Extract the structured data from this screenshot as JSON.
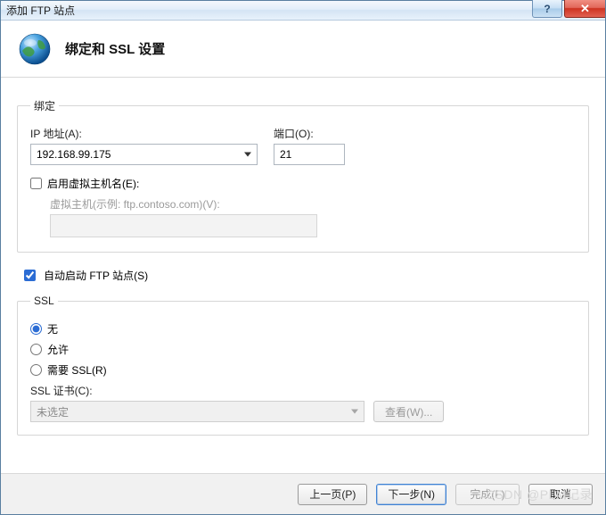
{
  "window": {
    "title": "添加 FTP 站点"
  },
  "header": {
    "title": "绑定和 SSL 设置"
  },
  "binding": {
    "legend": "绑定",
    "ip_label": "IP 地址(A):",
    "ip_value": "192.168.99.175",
    "port_label": "端口(O):",
    "port_value": "21",
    "vhost_checkbox": "启用虚拟主机名(E):",
    "vhost_label": "虚拟主机(示例: ftp.contoso.com)(V):",
    "vhost_value": ""
  },
  "auto_start": {
    "label": "自动启动 FTP 站点(S)"
  },
  "ssl": {
    "legend": "SSL",
    "opt_none": "无",
    "opt_allow": "允许",
    "opt_require": "需要 SSL(R)",
    "cert_label": "SSL 证书(C):",
    "cert_value": "未选定",
    "view_btn": "查看(W)..."
  },
  "footer": {
    "prev": "上一页(P)",
    "next": "下一步(N)",
    "finish": "完成(F)",
    "cancel": "取消"
  },
  "watermark": "CSDN @PLM记录"
}
